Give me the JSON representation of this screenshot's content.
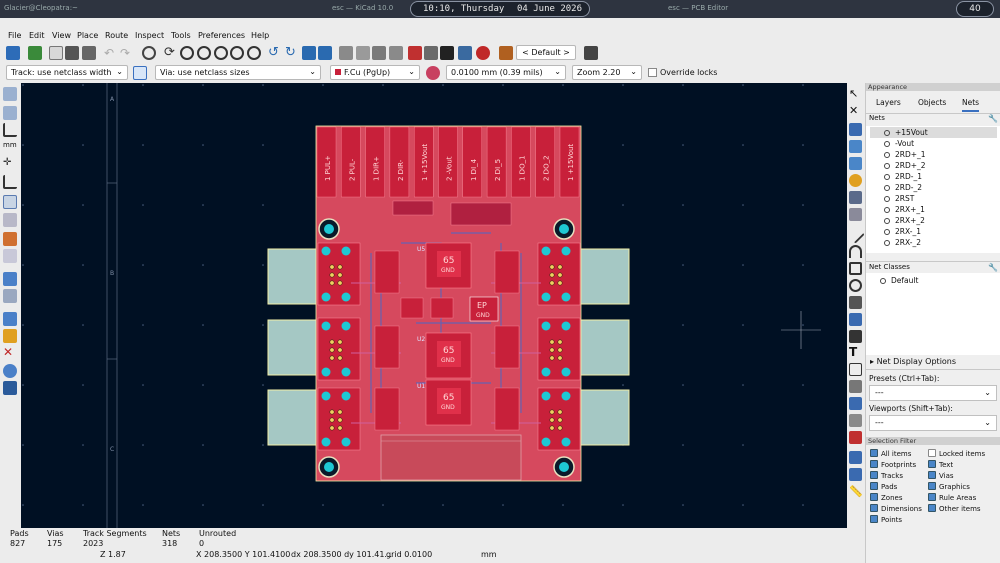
{
  "topbar": {
    "left_text": "Glacier@Cleopatra:~",
    "center_text": "esc — KiCad 10.0",
    "right_text": "esc — PCB Editor",
    "time": "10:10, Thursday",
    "date": "04 June 2026",
    "workspace": "40"
  },
  "menu": [
    "File",
    "Edit",
    "View",
    "Place",
    "Route",
    "Inspect",
    "Tools",
    "Preferences",
    "Help"
  ],
  "toolbar": {
    "zoom_preset_label": "< Default >"
  },
  "toolbar2": {
    "track": "Track: use netclass width",
    "via": "Via: use netclass sizes",
    "layer": "F.Cu (PgUp)",
    "grid": "0.0100 mm (0.39 mils)",
    "zoom": "Zoom 2.20",
    "override_locks": "Override locks"
  },
  "canvas": {
    "ruler_a": "A",
    "ruler_b": "B",
    "ruler_c": "C",
    "pad_labels": [
      {
        "num": "1",
        "name": "PUL+"
      },
      {
        "num": "2",
        "name": "PUL-"
      },
      {
        "num": "1",
        "name": "DIR+"
      },
      {
        "num": "2",
        "name": "DIR-"
      },
      {
        "num": "1",
        "name": "+15Vout"
      },
      {
        "num": "2",
        "name": "-Vout"
      },
      {
        "num": "1",
        "name": "DI_4"
      },
      {
        "num": "2",
        "name": "DI_5"
      },
      {
        "num": "1",
        "name": "DO_1"
      },
      {
        "num": "2",
        "name": "DO_2"
      },
      {
        "num": "1",
        "name": "+15Vout"
      }
    ],
    "ic_top": "65",
    "ic_mid": "65",
    "ic_bot": "65",
    "gnd": "GND",
    "ep": "EP",
    "ref_u5": "U5",
    "ref_u2": "U2",
    "ref_u1": "U1"
  },
  "panel": {
    "appearance": "Appearance",
    "tabs": [
      "Layers",
      "Objects",
      "Nets"
    ],
    "nets_header": "Nets",
    "nets": [
      "+15Vout",
      "-Vout",
      "2RD+_1",
      "2RD+_2",
      "2RD-_1",
      "2RD-_2",
      "2RST",
      "2RX+_1",
      "2RX+_2",
      "2RX-_1",
      "2RX-_2"
    ],
    "net_classes_header": "Net Classes",
    "net_class_default": "Default",
    "net_display_options": "Net Display Options",
    "presets_label": "Presets (Ctrl+Tab):",
    "presets_value": "---",
    "viewports_label": "Viewports (Shift+Tab):",
    "viewports_value": "---",
    "selection_filter": "Selection Filter",
    "filters_left": [
      "All items",
      "Footprints",
      "Tracks",
      "Pads",
      "Zones",
      "Dimensions",
      "Points"
    ],
    "filters_right": [
      "Locked items",
      "Text",
      "Vias",
      "Graphics",
      "Rule Areas",
      "Other items"
    ]
  },
  "status": {
    "pads_label": "Pads",
    "pads": "827",
    "vias_label": "Vias",
    "vias": "175",
    "tracks_label": "Track Segments",
    "tracks": "2023",
    "nets_label": "Nets",
    "nets": "318",
    "unrouted_label": "Unrouted",
    "unrouted": "0",
    "z": "Z 1.87",
    "xy": "X 208.3500  Y 101.4100",
    "dxdy": "dx 208.3500  dy 101.41...",
    "grid": "grid 0.0100",
    "units": "mm"
  },
  "colors": {
    "board": "#d6495e",
    "canvas_bg": "#001023",
    "pad_cyan": "#1ec8d4",
    "copper_pad": "#c8203a",
    "outline": "#f3f0a8"
  }
}
